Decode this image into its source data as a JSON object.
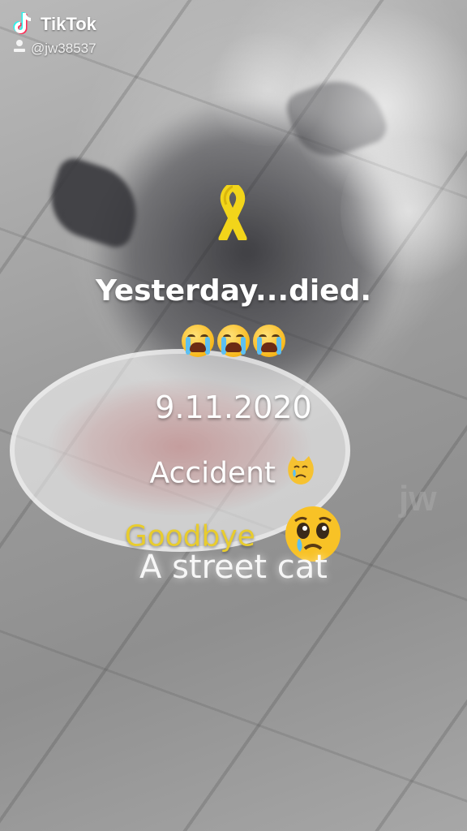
{
  "watermark": {
    "brand": "TikTok",
    "username": "@jw38537"
  },
  "overlay": {
    "ribbon_icon": "yellow-ribbon",
    "line1": "Yesterday...died.",
    "crying_emojis": [
      "loudly-crying-face",
      "loudly-crying-face",
      "loudly-crying-face"
    ],
    "date": "9.11.2020",
    "accident": "Accident",
    "accident_emoji": "crying-cat-face",
    "goodbye": "Goodbye",
    "goodbye_emoji": "pleading-face-with-tear",
    "street_cat": "A street cat",
    "corner_mark": "jw"
  },
  "colors": {
    "goodbye_text": "#e8cc2e",
    "ribbon": "#f2d51a"
  }
}
